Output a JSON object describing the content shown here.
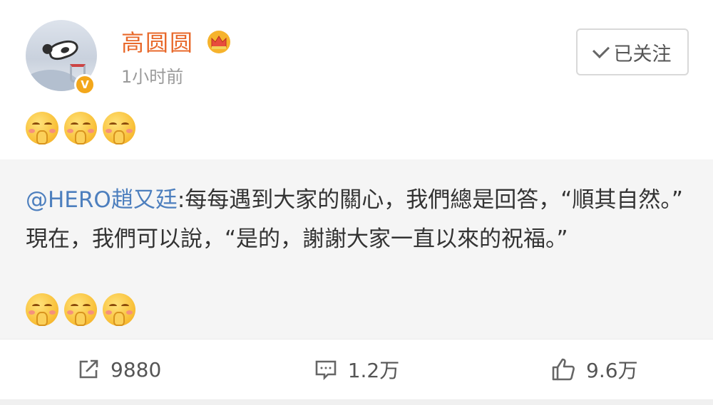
{
  "post": {
    "author": {
      "name": "高圆圆",
      "avatar_icon": "avatar-cat-basketball",
      "badge_icon": "crown-icon",
      "verified_icon": "verified-v-icon",
      "verified_mark": "V"
    },
    "time": "1小时前",
    "follow_button": {
      "label": "已关注",
      "icon": "check-icon"
    },
    "emojis": [
      "bashful-emoji",
      "bashful-emoji",
      "bashful-emoji"
    ]
  },
  "repost": {
    "mention": "@HERO趙又廷",
    "text_line1": ":每每遇到大家的關心，我們總是回答，“順其自然。”",
    "text_line2": "現在，我們可以說，“是的，謝謝大家一直以來的祝福。”",
    "emojis": [
      "bashful-emoji",
      "bashful-emoji",
      "bashful-emoji"
    ]
  },
  "actions": {
    "share": {
      "count": "9880",
      "icon": "share-icon"
    },
    "comment": {
      "count": "1.2万",
      "icon": "comment-icon"
    },
    "like": {
      "count": "9.6万",
      "icon": "thumbs-up-icon"
    }
  },
  "colors": {
    "username": "#e8692b",
    "mention": "#4d7fbe",
    "repost_bg": "#f5f5f5",
    "verified": "#f3a71b"
  }
}
